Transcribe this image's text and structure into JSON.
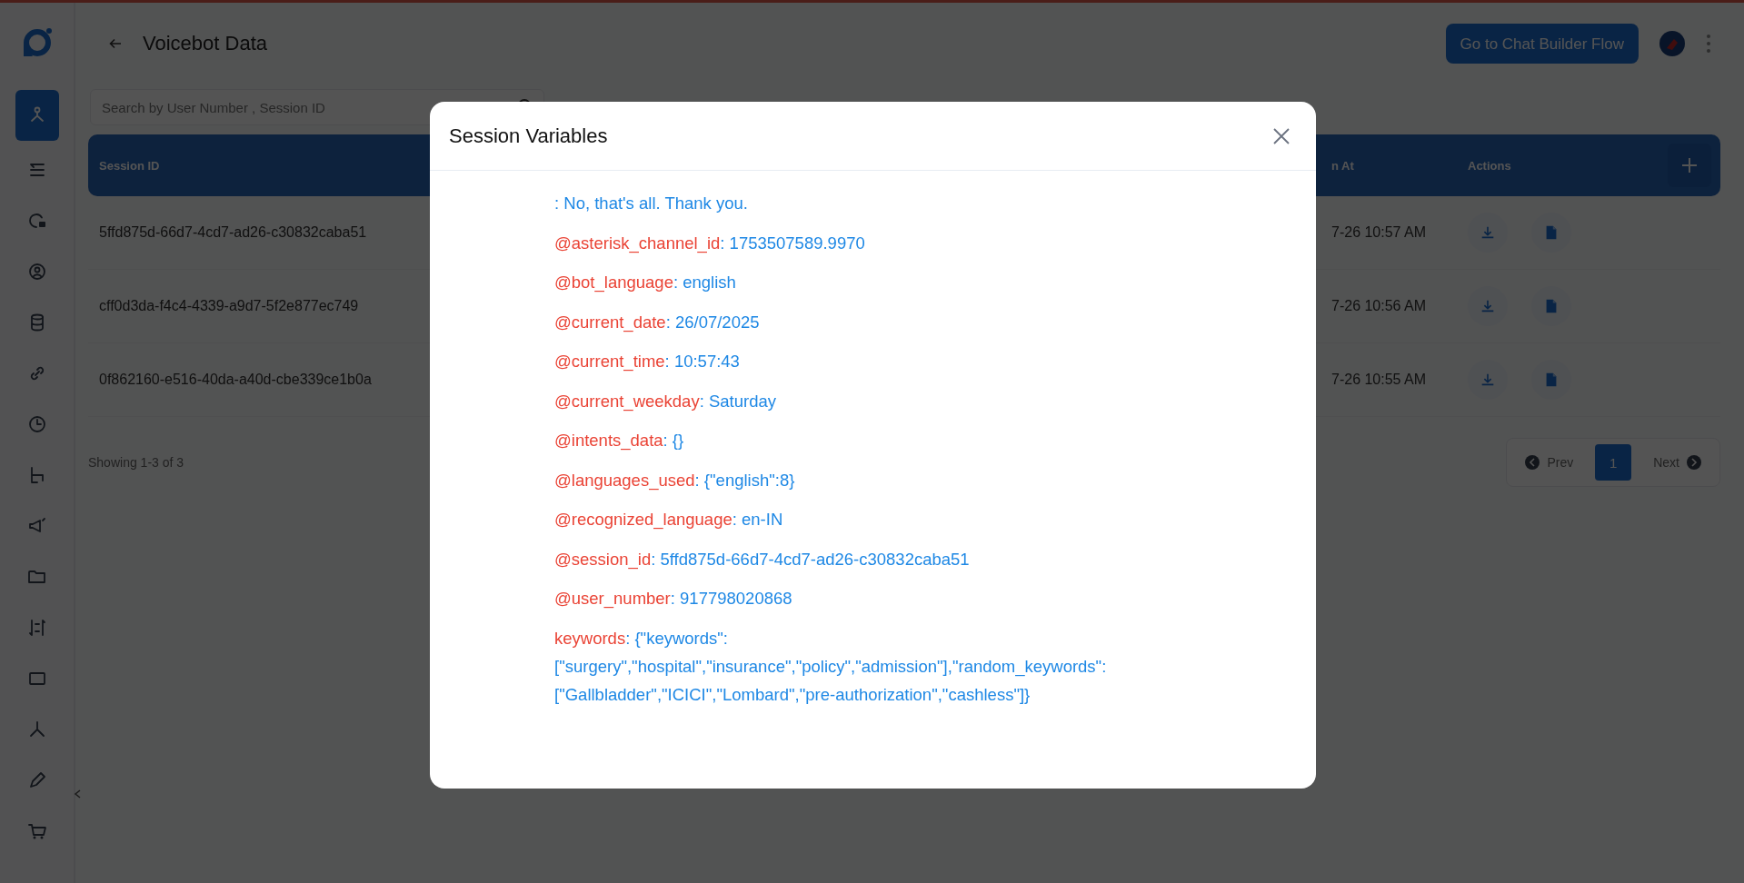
{
  "header": {
    "title": "Voicebot Data",
    "primary_button": "Go to Chat Builder Flow"
  },
  "sidebar": {
    "items": [
      {
        "selected": true
      },
      {
        "selected": false
      },
      {
        "selected": false
      },
      {
        "selected": false
      },
      {
        "selected": false
      },
      {
        "selected": false
      },
      {
        "selected": false
      },
      {
        "selected": false
      },
      {
        "selected": false
      },
      {
        "selected": false
      },
      {
        "selected": false
      },
      {
        "selected": false
      },
      {
        "selected": false
      },
      {
        "selected": false
      },
      {
        "selected": false
      }
    ]
  },
  "search": {
    "placeholder": "Search by User Number , Session ID"
  },
  "table": {
    "columns": [
      "Session ID",
      "n At",
      "Actions"
    ],
    "rows": [
      {
        "session_id": "5ffd875d-66d7-4cd7-ad26-c30832caba51",
        "column_2": "7-26 10:57 AM"
      },
      {
        "session_id": "cff0d3da-f4c4-4339-a9d7-5f2e877ec749",
        "column_2": "7-26 10:56 AM"
      },
      {
        "session_id": "0f862160-e516-40da-a40d-cbe339ce1b0a",
        "column_2": "7-26 10:55 AM"
      }
    ]
  },
  "footer": {
    "summary": "Showing 1-3 of 3",
    "prev": "Prev",
    "next": "Next",
    "pages": [
      {
        "label": "1",
        "selected": true
      }
    ]
  },
  "modal": {
    "title": "Session Variables",
    "variables": [
      {
        "value": ": No, that's all. Thank you."
      },
      {
        "name": "@asterisk_channel_id",
        "value": ": 1753507589.9970"
      },
      {
        "name": "@bot_language",
        "value": ": english"
      },
      {
        "name": "@current_date",
        "value": ": 26/07/2025"
      },
      {
        "name": "@current_time",
        "value": ": 10:57:43"
      },
      {
        "name": "@current_weekday",
        "value": ": Saturday"
      },
      {
        "name": "@intents_data",
        "value": ": {}"
      },
      {
        "name": "@languages_used",
        "value": ": {\"english\":8}"
      },
      {
        "name": "@recognized_language",
        "value": ": en-IN"
      },
      {
        "name": "@session_id",
        "value": ": 5ffd875d-66d7-4cd7-ad26-c30832caba51"
      },
      {
        "name": "@user_number",
        "value": ": 917798020868"
      },
      {
        "name": "keywords",
        "value": ": {\"keywords\": [\"surgery\",\"hospital\",\"insurance\",\"policy\",\"admission\"],\"random_keywords\": [\"Gallbladder\",\"ICICI\",\"Lombard\",\"pre-authorization\",\"cashless\"]}"
      }
    ]
  }
}
